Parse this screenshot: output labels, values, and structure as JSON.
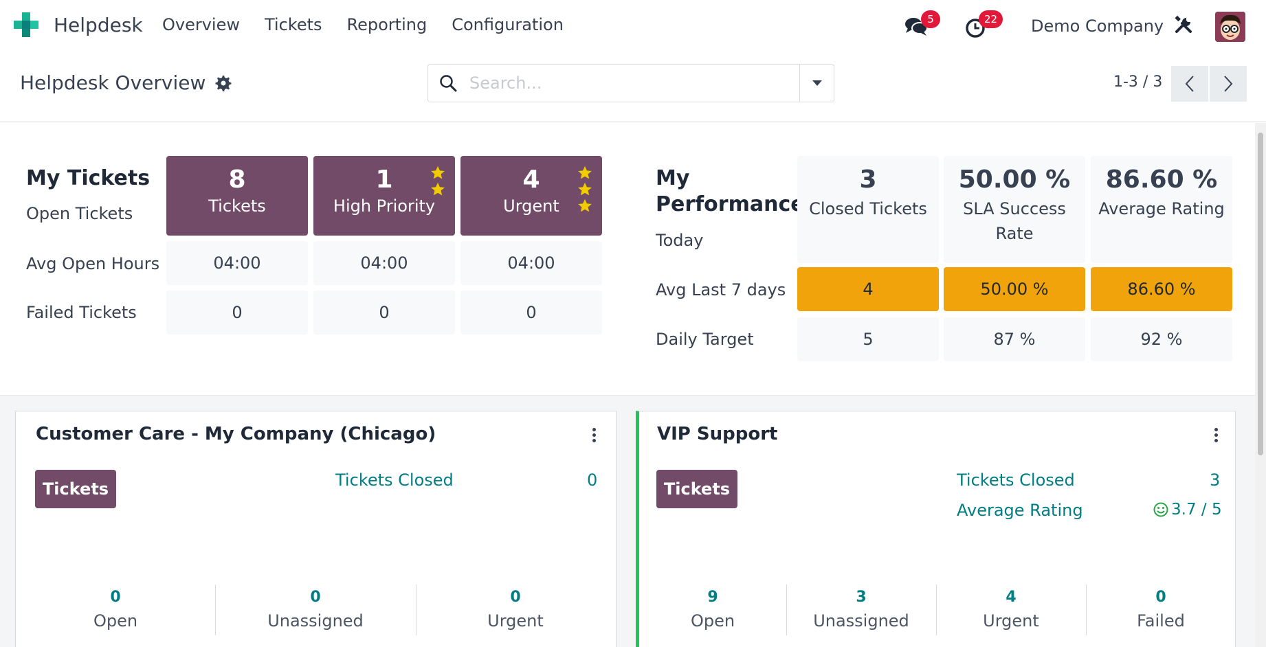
{
  "app": {
    "name": "Helpdesk"
  },
  "nav": {
    "items": [
      "Overview",
      "Tickets",
      "Reporting",
      "Configuration"
    ],
    "messages_badge": "5",
    "activities_badge": "22",
    "company": "Demo Company",
    "icons": {
      "logo": "helpdesk-logo-icon",
      "messages": "chat-icon",
      "activities": "clock-icon",
      "settings": "tools-icon"
    }
  },
  "control": {
    "title": "Helpdesk Overview",
    "search_placeholder": "Search...",
    "pager": "1-3 / 3"
  },
  "my_tickets": {
    "title": "My Tickets",
    "subtitle": "Open Tickets",
    "cols": [
      {
        "value": "8",
        "label": "Tickets",
        "stars": 0
      },
      {
        "value": "1",
        "label": "High Priority",
        "stars": 2
      },
      {
        "value": "4",
        "label": "Urgent",
        "stars": 3
      }
    ],
    "rows": [
      {
        "label": "Avg Open Hours",
        "values": [
          "04:00",
          "04:00",
          "04:00"
        ]
      },
      {
        "label": "Failed Tickets",
        "values": [
          "0",
          "0",
          "0"
        ]
      }
    ]
  },
  "my_performance": {
    "title_line1": "My",
    "title_line2": "Performance",
    "subtitle": "Today",
    "cols": [
      {
        "value": "3",
        "label": "Closed Tickets"
      },
      {
        "value": "50.00 %",
        "label": "SLA Success Rate"
      },
      {
        "value": "86.60 %",
        "label": "Average Rating"
      }
    ],
    "avg_label": "Avg Last 7 days",
    "avg_values": [
      "4",
      "50.00 %",
      "86.60 %"
    ],
    "target_label": "Daily Target",
    "target_values": [
      "5",
      "87 %",
      "92 %"
    ]
  },
  "colors": {
    "primary": "#714b67",
    "warning": "#f0a30a",
    "teal": "#017e84",
    "star": "#f3cc00",
    "success": "#28a745",
    "badge": "#e0193a"
  },
  "teams": [
    {
      "name": "Customer Care - My Company (Chicago)",
      "button": "Tickets",
      "links": [
        {
          "label": "Tickets Closed",
          "value": "0"
        }
      ],
      "stats": [
        {
          "value": "0",
          "label": "Open"
        },
        {
          "value": "0",
          "label": "Unassigned"
        },
        {
          "value": "0",
          "label": "Urgent"
        }
      ]
    },
    {
      "name": "VIP Support",
      "button": "Tickets",
      "links": [
        {
          "label": "Tickets Closed",
          "value": "3"
        },
        {
          "label": "Average Rating",
          "value": "3.7 / 5",
          "icon": "smile-icon"
        }
      ],
      "stats": [
        {
          "value": "9",
          "label": "Open"
        },
        {
          "value": "3",
          "label": "Unassigned"
        },
        {
          "value": "4",
          "label": "Urgent"
        },
        {
          "value": "0",
          "label": "Failed"
        }
      ]
    }
  ]
}
